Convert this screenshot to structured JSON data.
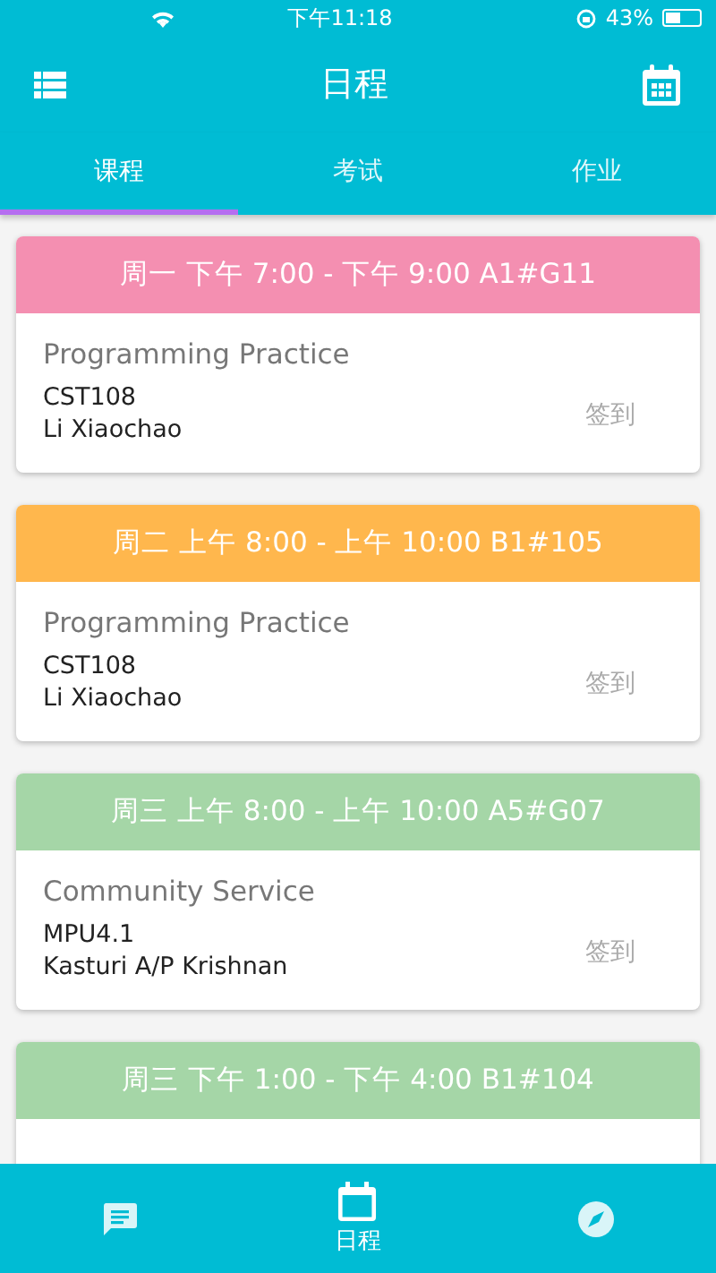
{
  "status_bar": {
    "time": "下午11:18",
    "battery": "43%"
  },
  "header": {
    "title": "日程"
  },
  "tabs": [
    {
      "label": "课程",
      "selected": true
    },
    {
      "label": "考试",
      "selected": false
    },
    {
      "label": "作业",
      "selected": false
    }
  ],
  "courses": [
    {
      "heading": "周一 下午 7:00 - 下午 9:00 A1#G11",
      "color": "#f48fb1",
      "name": "Programming Practice",
      "code": "CST108",
      "lecturer": "Li Xiaochao",
      "action": "签到"
    },
    {
      "heading": "周二 上午 8:00 - 上午 10:00 B1#105",
      "color": "#ffb74d",
      "name": "Programming Practice",
      "code": "CST108",
      "lecturer": "Li Xiaochao",
      "action": "签到"
    },
    {
      "heading": "周三 上午 8:00 - 上午 10:00 A5#G07",
      "color": "#a5d6a7",
      "name": "Community Service",
      "code": "MPU4.1",
      "lecturer": "Kasturi A/P Krishnan",
      "action": "签到"
    },
    {
      "heading": "周三 下午 1:00 - 下午 4:00 B1#104",
      "color": "#a5d6a7"
    }
  ],
  "bottom_nav": [
    {
      "kind": "chat",
      "selected": false
    },
    {
      "kind": "calendar",
      "label": "日程",
      "selected": true
    },
    {
      "kind": "compass",
      "selected": false
    }
  ]
}
